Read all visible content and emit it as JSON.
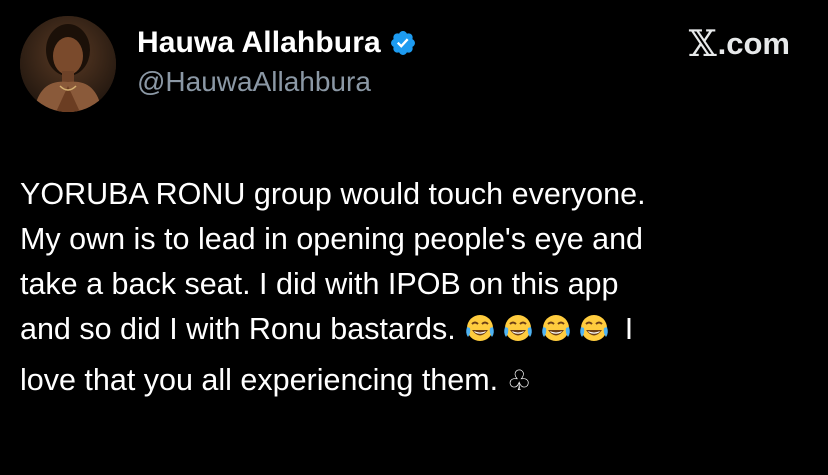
{
  "header": {
    "display_name": "Hauwa Allahbura",
    "handle": "@HauwaAllahbura",
    "brand_suffix": ".com",
    "brand_logo": "𝕏",
    "verified_color": "#1d9bf0"
  },
  "tweet": {
    "lines": [
      "YORUBA RONU group would touch everyone.",
      "My own is to lead in opening people's eye and",
      "take a back seat. I did with IPOB on this app",
      "and so did I with Ronu bastards.",
      "love that you all experiencing them."
    ],
    "line4_after_emoji": "I",
    "emoji_count": 4,
    "emoji_name": "face-with-tears-of-joy",
    "trailing_symbol": "♧"
  },
  "colors": {
    "background": "#000000",
    "text": "#ffffff",
    "secondary_text": "#8b98a5"
  }
}
